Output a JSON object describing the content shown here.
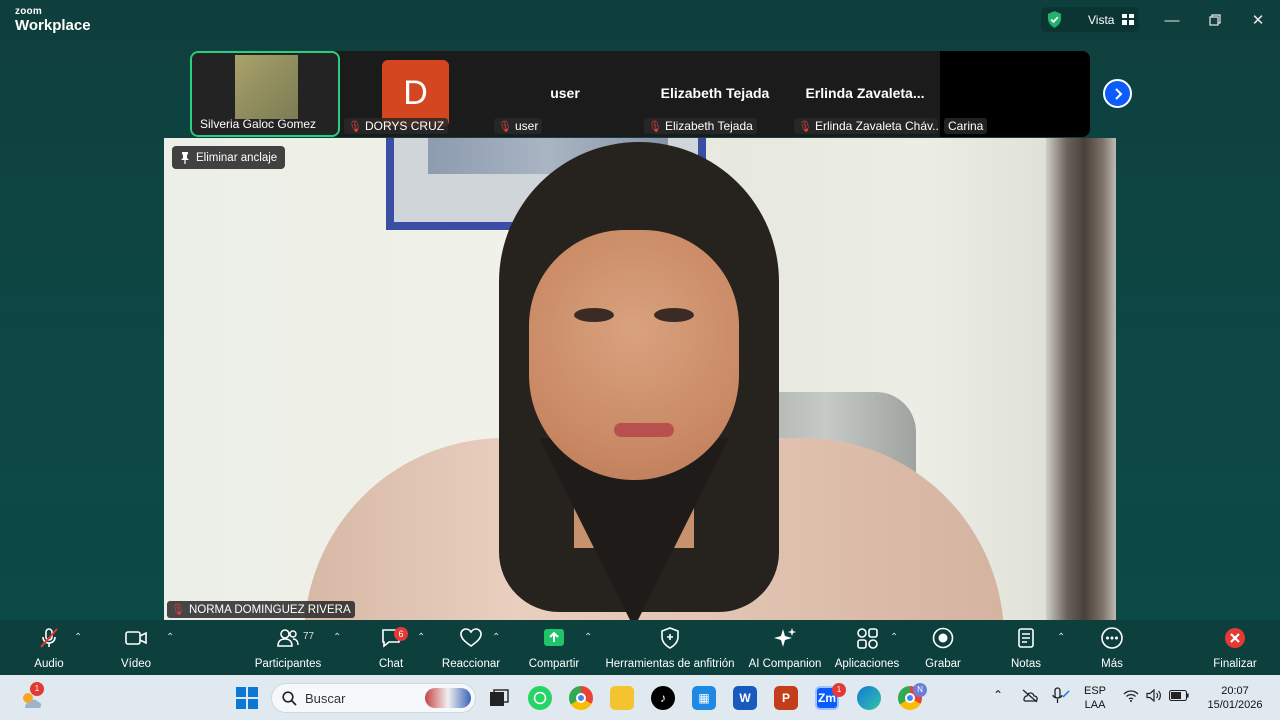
{
  "app": {
    "brand_small": "zoom",
    "brand_large": "Workplace",
    "view_label": "Vista"
  },
  "strip": {
    "tiles": [
      {
        "label": "Silveria Galoc Gomez",
        "big": "",
        "avatar": ""
      },
      {
        "label": "DORYS CRUZ",
        "big": "",
        "avatar": "D"
      },
      {
        "label": "user",
        "big": "user",
        "avatar": ""
      },
      {
        "label": "Elizabeth Tejada",
        "big": "Elizabeth Tejada",
        "avatar": ""
      },
      {
        "label": "Erlinda Zavaleta Cháv...",
        "big": "Erlinda  Zavaleta...",
        "avatar": ""
      },
      {
        "label": "Carina",
        "big": "",
        "avatar": ""
      }
    ]
  },
  "video": {
    "pin_label": "Eliminar anclaje",
    "speaker_name": "NORMA DOMINGUEZ RIVERA"
  },
  "toolbar": {
    "audio": "Audio",
    "video": "Vídeo",
    "participants": "Participantes",
    "participants_count": "77",
    "chat": "Chat",
    "chat_badge": "6",
    "react": "Reaccionar",
    "share": "Compartir",
    "host_tools": "Herramientas de anfitrión",
    "ai": "AI Companion",
    "apps": "Aplicaciones",
    "record": "Grabar",
    "notes": "Notas",
    "more": "Más",
    "end": "Finalizar"
  },
  "taskbar": {
    "weather_badge": "1",
    "search_placeholder": "Buscar",
    "lang_top": "ESP",
    "lang_bottom": "LAA",
    "time": "20:07",
    "date": "15/01/2026",
    "zoom_badge": "1",
    "chrome_profile": "N"
  },
  "colors": {
    "accent_green": "#29d07f",
    "zoom_blue": "#0b5cff",
    "end_red": "#e53935",
    "toolbar_bg": "#0d3f3d"
  }
}
